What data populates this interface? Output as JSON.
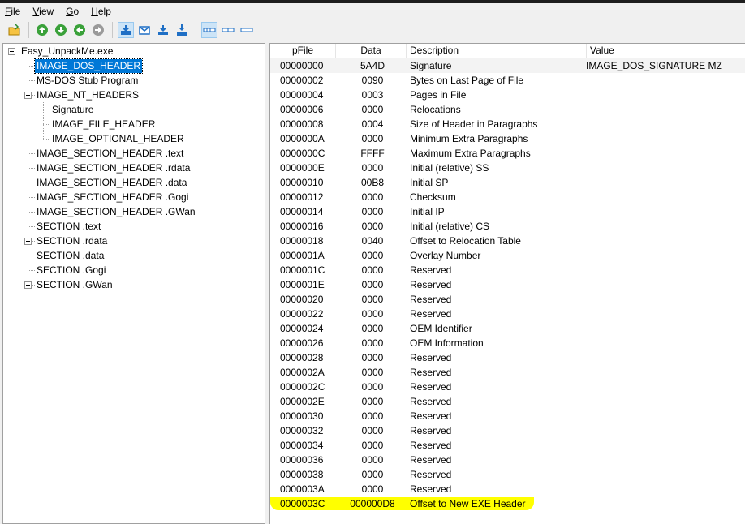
{
  "menu": [
    "File",
    "View",
    "Go",
    "Help"
  ],
  "tree": [
    {
      "label": "Easy_UnpackMe.exe",
      "level": 0
    },
    {
      "label": "IMAGE_DOS_HEADER",
      "level": 1,
      "selected": true
    },
    {
      "label": "MS-DOS Stub Program",
      "level": 1
    },
    {
      "label": "IMAGE_NT_HEADERS",
      "level": 1,
      "expander": "minus"
    },
    {
      "label": "Signature",
      "level": 2
    },
    {
      "label": "IMAGE_FILE_HEADER",
      "level": 2
    },
    {
      "label": "IMAGE_OPTIONAL_HEADER",
      "level": 2
    },
    {
      "label": "IMAGE_SECTION_HEADER .text",
      "level": 1
    },
    {
      "label": "IMAGE_SECTION_HEADER .rdata",
      "level": 1
    },
    {
      "label": "IMAGE_SECTION_HEADER .data",
      "level": 1
    },
    {
      "label": "IMAGE_SECTION_HEADER .Gogi",
      "level": 1
    },
    {
      "label": "IMAGE_SECTION_HEADER .GWan",
      "level": 1
    },
    {
      "label": "SECTION .text",
      "level": 1
    },
    {
      "label": "SECTION .rdata",
      "level": 1,
      "expander": "plus"
    },
    {
      "label": "SECTION .data",
      "level": 1
    },
    {
      "label": "SECTION .Gogi",
      "level": 1
    },
    {
      "label": "SECTION .GWan",
      "level": 1,
      "expander": "plus"
    }
  ],
  "columns": [
    "pFile",
    "Data",
    "Description",
    "Value"
  ],
  "rows": [
    [
      "00000000",
      "5A4D",
      "Signature",
      "IMAGE_DOS_SIGNATURE  MZ"
    ],
    [
      "00000002",
      "0090",
      "Bytes on Last Page of File",
      ""
    ],
    [
      "00000004",
      "0003",
      "Pages in File",
      ""
    ],
    [
      "00000006",
      "0000",
      "Relocations",
      ""
    ],
    [
      "00000008",
      "0004",
      "Size of Header in Paragraphs",
      ""
    ],
    [
      "0000000A",
      "0000",
      "Minimum Extra Paragraphs",
      ""
    ],
    [
      "0000000C",
      "FFFF",
      "Maximum Extra Paragraphs",
      ""
    ],
    [
      "0000000E",
      "0000",
      "Initial (relative) SS",
      ""
    ],
    [
      "00000010",
      "00B8",
      "Initial SP",
      ""
    ],
    [
      "00000012",
      "0000",
      "Checksum",
      ""
    ],
    [
      "00000014",
      "0000",
      "Initial IP",
      ""
    ],
    [
      "00000016",
      "0000",
      "Initial (relative) CS",
      ""
    ],
    [
      "00000018",
      "0040",
      "Offset to Relocation Table",
      ""
    ],
    [
      "0000001A",
      "0000",
      "Overlay Number",
      ""
    ],
    [
      "0000001C",
      "0000",
      "Reserved",
      ""
    ],
    [
      "0000001E",
      "0000",
      "Reserved",
      ""
    ],
    [
      "00000020",
      "0000",
      "Reserved",
      ""
    ],
    [
      "00000022",
      "0000",
      "Reserved",
      ""
    ],
    [
      "00000024",
      "0000",
      "OEM Identifier",
      ""
    ],
    [
      "00000026",
      "0000",
      "OEM Information",
      ""
    ],
    [
      "00000028",
      "0000",
      "Reserved",
      ""
    ],
    [
      "0000002A",
      "0000",
      "Reserved",
      ""
    ],
    [
      "0000002C",
      "0000",
      "Reserved",
      ""
    ],
    [
      "0000002E",
      "0000",
      "Reserved",
      ""
    ],
    [
      "00000030",
      "0000",
      "Reserved",
      ""
    ],
    [
      "00000032",
      "0000",
      "Reserved",
      ""
    ],
    [
      "00000034",
      "0000",
      "Reserved",
      ""
    ],
    [
      "00000036",
      "0000",
      "Reserved",
      ""
    ],
    [
      "00000038",
      "0000",
      "Reserved",
      ""
    ],
    [
      "0000003A",
      "0000",
      "Reserved",
      ""
    ],
    [
      "0000003C",
      "000000D8",
      "Offset to New EXE Header",
      "",
      "highlight"
    ]
  ],
  "colors": {
    "highlight": "#ffff00",
    "selection": "#0078d7"
  },
  "toolbar_icons": [
    "open-icon",
    "nav-up-icon",
    "nav-down-icon",
    "back-icon",
    "forward-icon",
    "jump-icon",
    "mail-icon",
    "download-icon",
    "save-icon",
    "view-list-icon",
    "view-small-icon",
    "view-wide-icon"
  ]
}
